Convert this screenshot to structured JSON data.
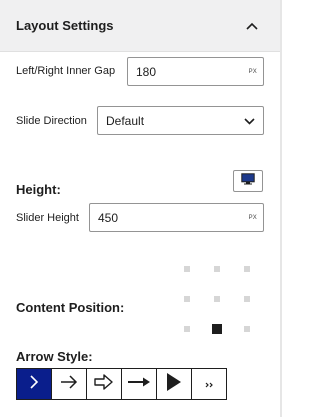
{
  "panel": {
    "title": "Layout Settings"
  },
  "inner_gap": {
    "label": "Left/Right Inner Gap",
    "value": "180",
    "unit": "PX"
  },
  "slide_direction": {
    "label": "Slide Direction",
    "selected": "Default"
  },
  "height": {
    "section_label": "Height:",
    "slider_label": "Slider Height",
    "value": "450",
    "unit": "PX"
  },
  "content_position": {
    "label": "Content Position:",
    "selected": "bottom-center"
  },
  "arrow_style": {
    "label": "Arrow Style:",
    "options": [
      "chevron-right",
      "arrow-right",
      "outline-arrow-right",
      "long-arrow-right",
      "triangle-right",
      "double-chevron-small"
    ],
    "selected_index": 0
  },
  "colors": {
    "selected_arrow_bg": "#0a1e8c",
    "active_dot": "#1e1e1e",
    "inactive_dot": "#d6d6d6"
  }
}
